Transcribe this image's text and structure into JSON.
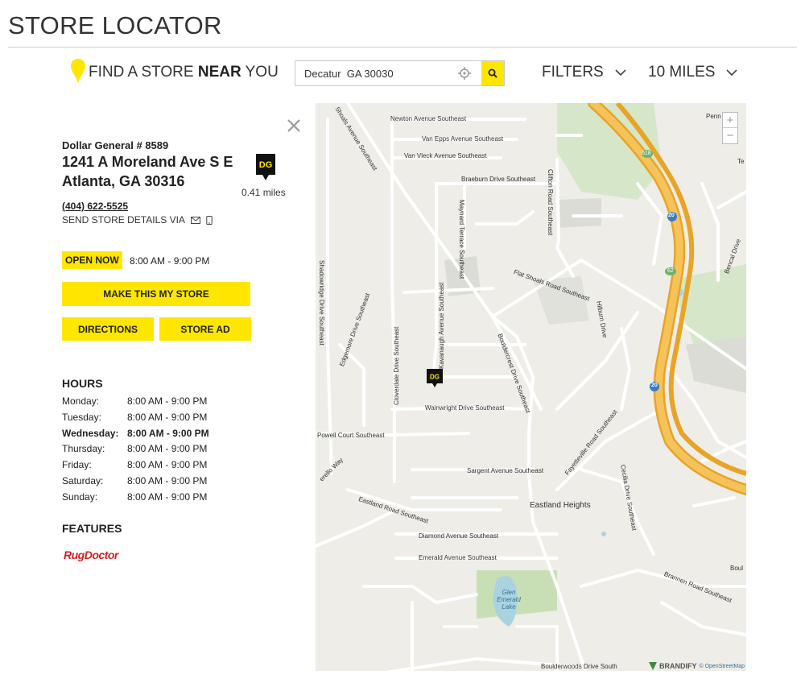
{
  "header": {
    "title": "STORE LOCATOR"
  },
  "search": {
    "label_prefix": "FIND A STORE ",
    "label_bold": "NEAR",
    "label_suffix": " YOU",
    "value": "Decatur  GA 30030",
    "filters_label": "FILTERS",
    "radius_label": "10 MILES"
  },
  "store": {
    "number": "Dollar General # 8589",
    "street": "1241 A Moreland Ave S E",
    "city": "Atlanta, GA 30316",
    "logo_text": "DG",
    "distance": "0.41 miles",
    "phone": "(404) 622-5525",
    "send_details": "SEND STORE DETAILS VIA",
    "open_status": "OPEN NOW",
    "open_hours": "8:00 AM - 9:00 PM",
    "make_my_store": "MAKE THIS MY STORE",
    "directions": "DIRECTIONS",
    "store_ad": "STORE AD"
  },
  "hours": {
    "title": "HOURS",
    "days": [
      {
        "day": "Monday:",
        "time": "8:00 AM - 9:00 PM"
      },
      {
        "day": "Tuesday:",
        "time": "8:00 AM - 9:00 PM"
      },
      {
        "day": "Wednesday:",
        "time": "8:00 AM - 9:00 PM"
      },
      {
        "day": "Thursday:",
        "time": "8:00 AM - 9:00 PM"
      },
      {
        "day": "Friday:",
        "time": "8:00 AM - 9:00 PM"
      },
      {
        "day": "Saturday:",
        "time": "8:00 AM - 9:00 PM"
      },
      {
        "day": "Sunday:",
        "time": "8:00 AM - 9:00 PM"
      }
    ]
  },
  "features": {
    "title": "FEATURES",
    "items": [
      "RugDoctor"
    ]
  },
  "map": {
    "labels": {
      "newton": "Newton Avenue Southeast",
      "vanepps": "Van Epps Avenue Southeast",
      "vanvleck": "Van Vleck Avenue Southeast",
      "braeburn": "Braeburn Drive Southeast",
      "flatshoals": "Flat Shoals Road Southeast",
      "wainwright": "Wainwright Drive Southeast",
      "powell": "Powell Court Southeast",
      "sargent": "Sargent Avenue Southeast",
      "eastland": "Eastland Road Southeast",
      "eastlandheights": "Eastland Heights",
      "diamond": "Diamond Avenue Southeast",
      "emerald": "Emerald Avenue Southeast",
      "glenemerald": "Glen Emerald Lake",
      "boulderwoods": "Boulderwoods Drive South",
      "brannen": "Brannen Road Southeast",
      "boulevard": "Boul",
      "penn": "Penn",
      "te": "Te",
      "shadowridge": "Shadowridge Drive Southeast",
      "edgemore": "Edgemore Drive Southeast",
      "cloverdale": "Cloverdale Drive Southeast",
      "kavanaugh": "Kavanaugh Avenue Southeast",
      "maynard": "Maynard Terrace Southeast",
      "clifton": "Clifton Road Southeast",
      "bouldercrest": "Bouldercrest Drive Southeast",
      "fayetteville": "Fayetteville Road Southeast",
      "cecilia": "Cecilia Drive Southeast",
      "hilburn": "Hilburn Drive",
      "bencal": "Bencal Drive",
      "shoals": "Shoals Avenue Southeast",
      "erello": "erello Way",
      "i20a": "20",
      "i20b": "20",
      "hwy618": "618",
      "hwy62": "62"
    },
    "zoom_in": "+",
    "zoom_out": "−",
    "pin_text": "DG",
    "brandify": "BRANDIFY",
    "osm": "© OpenStreetMap"
  },
  "colors": {
    "accent": "#ffe600",
    "highway": "#f4b033",
    "water": "#aad3df",
    "park": "#c8dfb6"
  }
}
